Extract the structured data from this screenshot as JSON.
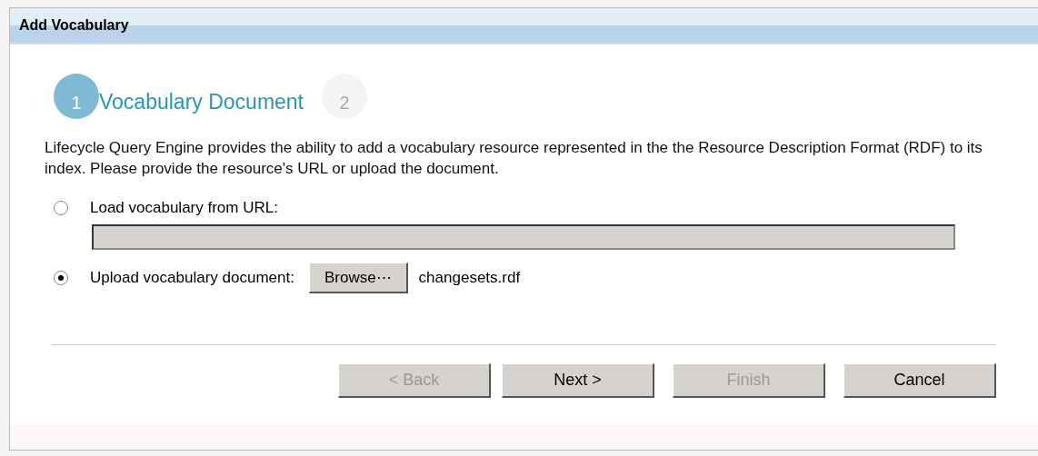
{
  "window": {
    "title": "Add Vocabulary"
  },
  "steps": [
    {
      "number": "1",
      "label": "Vocabulary Document",
      "selected": true
    },
    {
      "number": "2",
      "selected": false
    }
  ],
  "description": "Lifecycle Query Engine provides the ability to add a vocabulary resource represented in the the Resource Description Format (RDF) to its index. Please provide the resource's URL or upload the document.",
  "options": [
    {
      "kind": "url",
      "label": "Load vocabulary from URL:",
      "selected": false,
      "field": {
        "disabled": true
      }
    },
    {
      "kind": "upload",
      "label": "Upload vocabulary document:",
      "selected": true,
      "button": "Browse⋯",
      "file": "changesets.rdf"
    }
  ],
  "buttons": [
    {
      "label": "< Back",
      "disabled": true
    },
    {
      "label": "Next >",
      "disabled": false
    },
    {
      "label": "Finish",
      "disabled": true
    },
    {
      "label": "Cancel",
      "disabled": false
    }
  ]
}
